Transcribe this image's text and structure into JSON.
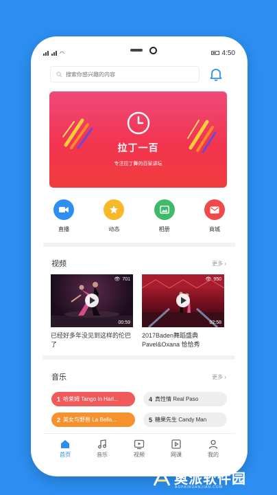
{
  "status": {
    "time": "4:50"
  },
  "search": {
    "placeholder": "搜索你感兴趣的内容"
  },
  "banner": {
    "title": "拉丁一百",
    "subtitle": "专注拉丁舞的百家讲坛"
  },
  "quick": [
    {
      "label": "直播",
      "icon": "video-camera-icon",
      "color": "#2e8ff2"
    },
    {
      "label": "动态",
      "icon": "star-icon",
      "color": "#f7b829"
    },
    {
      "label": "相册",
      "icon": "image-icon",
      "color": "#3dbb67"
    },
    {
      "label": "商城",
      "icon": "mail-icon",
      "color": "#ee4a4a"
    }
  ],
  "video_section": {
    "title": "视频",
    "more": "更多",
    "items": [
      {
        "title": "已经好多年没见到这样的伦巴了",
        "views": "701",
        "duration": "00:59"
      },
      {
        "title": "2017Baden舞蹈盛典 Pavel&Oxana 恰恰秀",
        "views": "950",
        "duration": "02:58"
      }
    ]
  },
  "music_section": {
    "title": "音乐",
    "more": "更多",
    "items": [
      {
        "num": "1",
        "text": "哈莱姆 Tango In Harl...",
        "style": "highlight"
      },
      {
        "num": "2",
        "text": "美女与野兽 La Bella...",
        "style": "highlight"
      },
      {
        "num": "4",
        "text": "真性情 Real Paso",
        "style": "plain"
      },
      {
        "num": "5",
        "text": "糖果先生 Candy Man",
        "style": "plain"
      }
    ]
  },
  "tabs": [
    {
      "label": "首页",
      "icon": "home-icon"
    },
    {
      "label": "音乐",
      "icon": "music-note-icon"
    },
    {
      "label": "视频",
      "icon": "play-box-icon"
    },
    {
      "label": "网课",
      "icon": "class-icon"
    },
    {
      "label": "我的",
      "icon": "user-icon"
    }
  ],
  "watermark": {
    "text": "奥派软件园",
    "sub": "AOPAIRUANJIAN.COM"
  },
  "colors": {
    "accent": "#2b8ef0",
    "banner_pink": "#ef4a7a",
    "banner_red": "#f13d3d"
  }
}
